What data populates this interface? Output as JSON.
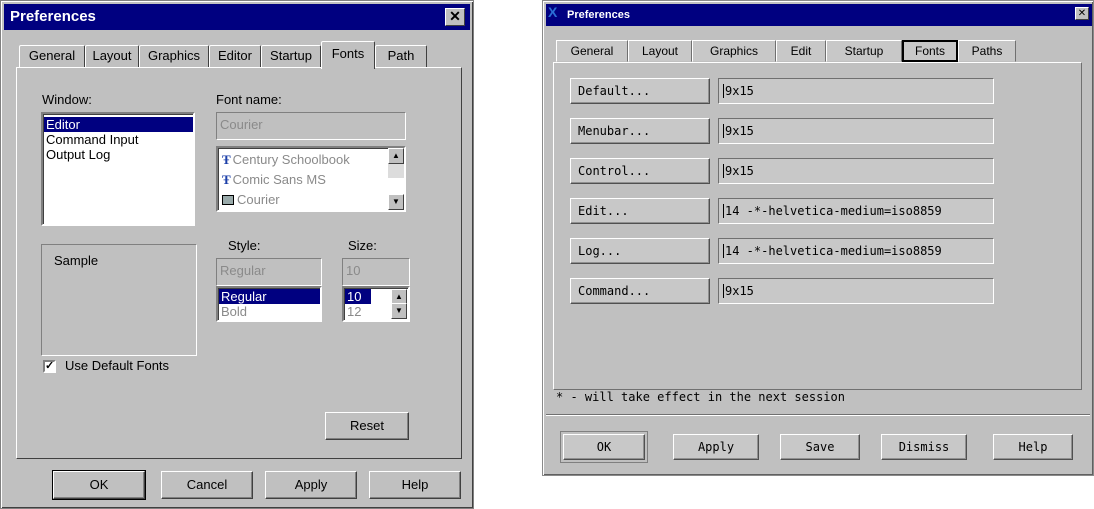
{
  "windows_dialog": {
    "title": "Preferences",
    "close_glyph": "✕",
    "tabs": [
      "General",
      "Layout",
      "Graphics",
      "Editor",
      "Startup",
      "Fonts",
      "Path"
    ],
    "active_tab": "Fonts",
    "window_label": "Window:",
    "window_items": [
      "Editor",
      "Command Input",
      "Output Log"
    ],
    "window_selected": "Editor",
    "font_name_label": "Font name:",
    "font_name_value": "Courier",
    "font_list": [
      {
        "name": "Century Schoolbook",
        "icon": "truetype-icon"
      },
      {
        "name": "Comic Sans MS",
        "icon": "truetype-icon"
      },
      {
        "name": "Courier",
        "icon": "printer-font-icon"
      }
    ],
    "sample_label": "Sample",
    "style_label": "Style:",
    "style_value": "Regular",
    "style_options": [
      "Regular",
      "Bold"
    ],
    "size_label": "Size:",
    "size_value": "10",
    "size_options": [
      "10",
      "12"
    ],
    "use_default_fonts_label": "Use Default Fonts",
    "use_default_fonts_checked": true,
    "check_glyph": "✓",
    "reset_label": "Reset",
    "buttons": {
      "ok": "OK",
      "cancel": "Cancel",
      "apply": "Apply",
      "help": "Help"
    }
  },
  "x_dialog": {
    "title": "Preferences",
    "close_glyph": "✕",
    "logo_glyph": "X",
    "tabs": [
      "General",
      "Layout",
      "Graphics",
      "Edit",
      "Startup",
      "Fonts",
      "Paths"
    ],
    "active_tab": "Fonts",
    "font_rows": [
      {
        "button": "Default...",
        "value": "9x15"
      },
      {
        "button": "Menubar...",
        "value": "9x15"
      },
      {
        "button": "Control...",
        "value": "9x15"
      },
      {
        "button": "Edit...",
        "value": "14 -*-helvetica-medium=iso8859"
      },
      {
        "button": "Log...",
        "value": "14 -*-helvetica-medium=iso8859"
      },
      {
        "button": "Command...",
        "value": "9x15"
      }
    ],
    "note": "* - will take effect in the next session",
    "buttons": {
      "ok": "OK",
      "apply": "Apply",
      "save": "Save",
      "dismiss": "Dismiss",
      "help": "Help"
    }
  },
  "colors": {
    "title_bar": "#000080",
    "face": "#c0c0c0",
    "selection": "#000080"
  }
}
